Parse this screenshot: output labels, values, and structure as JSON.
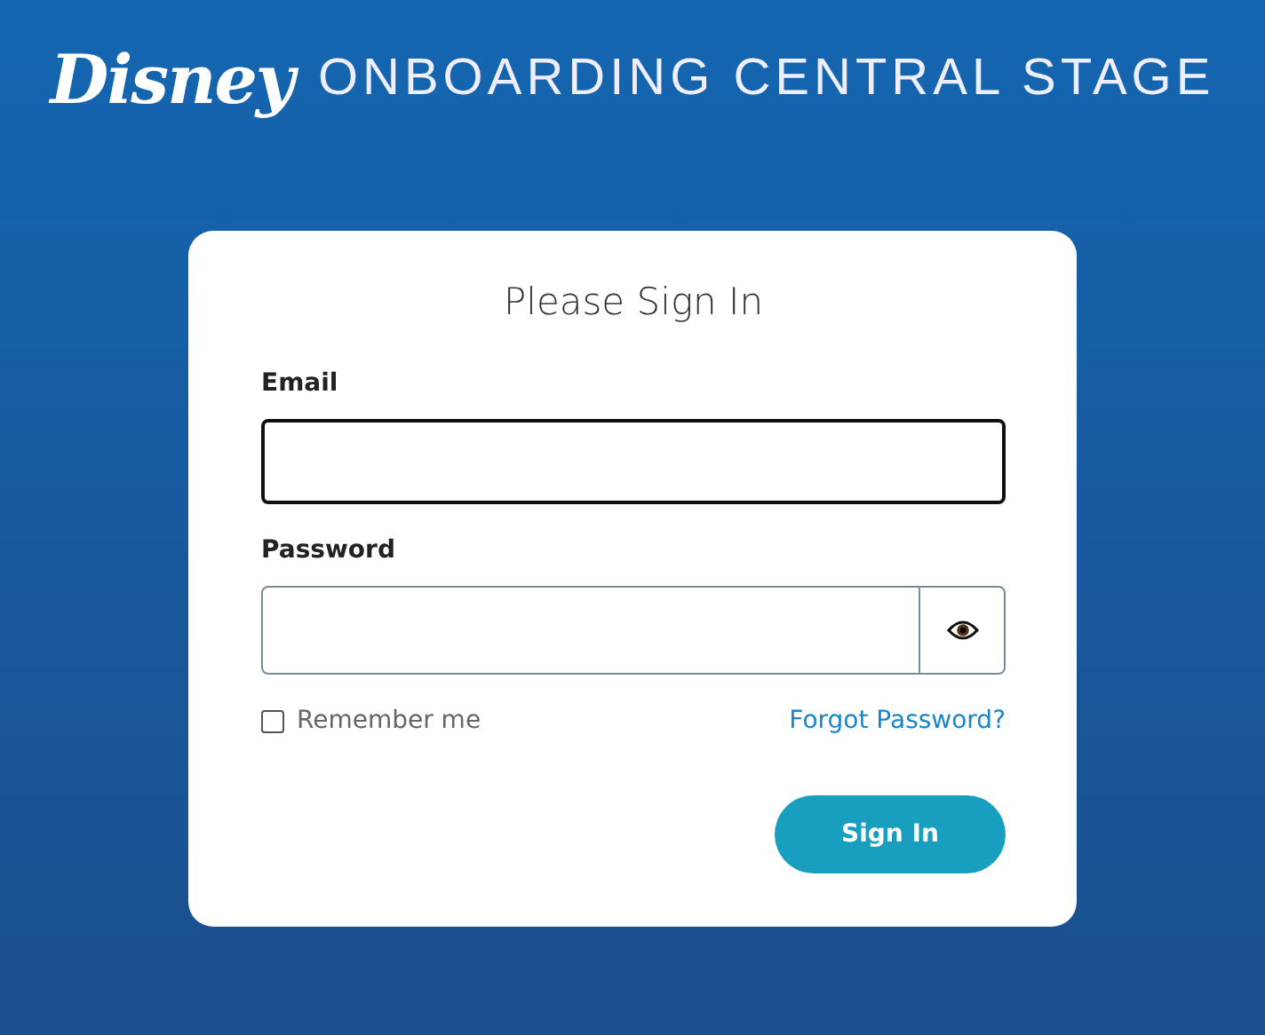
{
  "header": {
    "logo": "Disney",
    "title": "ONBOARDING CENTRAL STAGE"
  },
  "card": {
    "title": "Please Sign In",
    "fields": [
      {
        "kind": "text",
        "label": "Email",
        "focused": true
      },
      {
        "kind": "password",
        "label": "Password",
        "focused": false,
        "reveal_button": true
      }
    ],
    "remember": {
      "label": "Remember me",
      "checked": false
    },
    "forgot_link": "Forgot Password?",
    "submit": "Sign In"
  }
}
